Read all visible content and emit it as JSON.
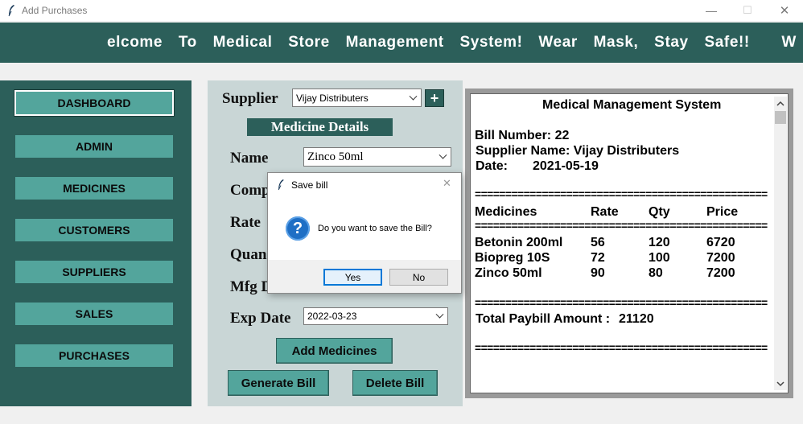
{
  "window": {
    "title": "Add Purchases",
    "controls": {
      "minimize": "—",
      "maximize": "☐",
      "close": "✕"
    }
  },
  "banner": {
    "text": "elcome  To  Medical  Store  Management  System!  Wear  Mask,  Stay  Safe!!    W"
  },
  "sidebar": {
    "items": [
      {
        "label": "DASHBOARD",
        "active": true
      },
      {
        "label": "ADMIN"
      },
      {
        "label": "MEDICINES"
      },
      {
        "label": "CUSTOMERS"
      },
      {
        "label": "SUPPLIERS"
      },
      {
        "label": "SALES"
      },
      {
        "label": "PURCHASES"
      }
    ]
  },
  "form": {
    "supplier_label": "Supplier",
    "supplier_value": "Vijay Distributers",
    "add_supplier": "+",
    "section_title": "Medicine Details",
    "name_label": "Name",
    "name_value": "Zinco 50ml",
    "company_label": "Comp",
    "rate_label": "Rate",
    "quantity_label": "Quan",
    "mfg_label": "Mfg D",
    "exp_label": "Exp Date",
    "exp_value": "2022-03-23",
    "add_medicines": "Add Medicines",
    "generate_bill": "Generate Bill",
    "delete_bill": "Delete Bill"
  },
  "bill": {
    "heading": "Medical Management System",
    "bill_number": "Bill Number: 22",
    "supplier": "Supplier Name: Vijay Distributers",
    "date_label": "Date:",
    "date_value": "2021-05-19",
    "separator": "================================================",
    "columns": [
      "Medicines",
      "Rate",
      "Qty",
      "Price"
    ],
    "rows": [
      [
        "Betonin 200ml",
        "56",
        "120",
        "6720"
      ],
      [
        "Biopreg 10S",
        "72",
        "100",
        "7200"
      ],
      [
        "Zinco 50ml",
        "90",
        "80",
        "7200"
      ]
    ],
    "total_label": "Total Paybill Amount :",
    "total_value": "21120"
  },
  "dialog": {
    "title": "Save bill",
    "message": "Do you want to save the Bill?",
    "icon_glyph": "?",
    "yes": "Yes",
    "no": "No",
    "close": "✕"
  },
  "colors": {
    "primary_dark": "#2c5f5a",
    "button_teal": "#53a59c",
    "panel_bg": "#c9d6d6",
    "dialog_accent": "#0078d7"
  }
}
